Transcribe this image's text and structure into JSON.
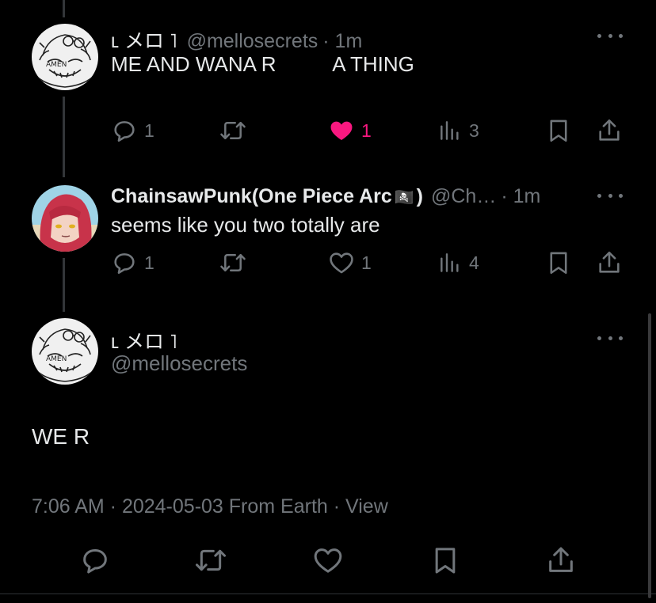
{
  "tweets": [
    {
      "name": "ʟ メロ ˥",
      "handle": "@mellosecrets",
      "time": "· 1m",
      "text": "ME AND WANA R          A THING",
      "replies": "1",
      "retweets": "",
      "likes": "1",
      "views": "3",
      "liked": true,
      "avatar": "sketch-avatar"
    },
    {
      "name": "ChainsawPunk(One Piece Arc",
      "name_suffix": ")",
      "flag": "🏴‍☠️",
      "handle": "@Ch…",
      "time": "· 1m",
      "text": "seems like you two totally are",
      "replies": "1",
      "retweets": "",
      "likes": "1",
      "views": "4",
      "liked": false,
      "avatar": "red-hair-avatar"
    }
  ],
  "main_tweet": {
    "name": "ʟ メロ ˥",
    "handle": "@mellosecrets",
    "text": "WE R",
    "meta": "7:06 AM · 2024-05-03 From Earth · View",
    "avatar": "sketch-avatar"
  },
  "colors": {
    "background": "#000000",
    "text": "#e7e9ea",
    "muted": "#71767b",
    "like": "#f91880"
  }
}
